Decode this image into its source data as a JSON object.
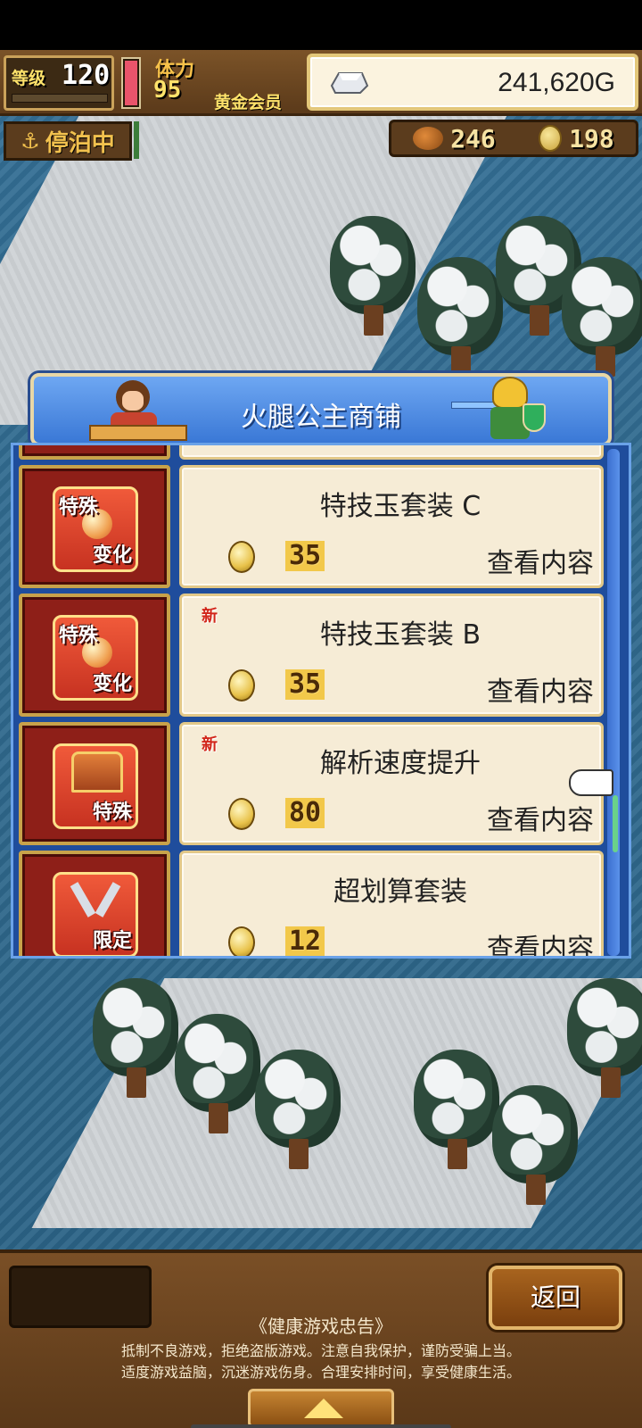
{
  "hud": {
    "level_label": "等级",
    "level_value": "120",
    "stamina_label": "体力",
    "stamina_value": "95",
    "membership": "黄金会员",
    "gold": "241,620G",
    "dock_status": "停泊中",
    "food_count": "246",
    "medal_count": "198"
  },
  "shop": {
    "title": "火腿公主商铺",
    "items": [
      {
        "badge_top": "特殊",
        "badge_bottom": "变化",
        "name": "特技玉套装 C",
        "price": "35",
        "action": "查看内容",
        "is_new": false,
        "new_label": ""
      },
      {
        "badge_top": "特殊",
        "badge_bottom": "变化",
        "name": "特技玉套装 B",
        "price": "35",
        "action": "查看内容",
        "is_new": true,
        "new_label": "新"
      },
      {
        "badge_top": "",
        "badge_bottom": "特殊",
        "name": "解析速度提升",
        "price": "80",
        "action": "查看内容",
        "is_new": true,
        "new_label": "新"
      },
      {
        "badge_top": "",
        "badge_bottom": "限定",
        "name": "超划算套装",
        "price": "12",
        "action": "查看内容",
        "is_new": false,
        "new_label": ""
      }
    ]
  },
  "bottom": {
    "back_label": "返回",
    "advice_title": "《健康游戏忠告》",
    "advice_line1": "抵制不良游戏，拒绝盗版游戏。注意自我保护，谨防受骗上当。",
    "advice_line2": "适度游戏益脑，沉迷游戏伤身。合理安排时间，享受健康生活。"
  },
  "colors": {
    "header_blue": "#3a78d6",
    "card_bg": "#f6ecd6",
    "badge_red": "#8e1f18",
    "accent_gold": "#f2c84a"
  }
}
